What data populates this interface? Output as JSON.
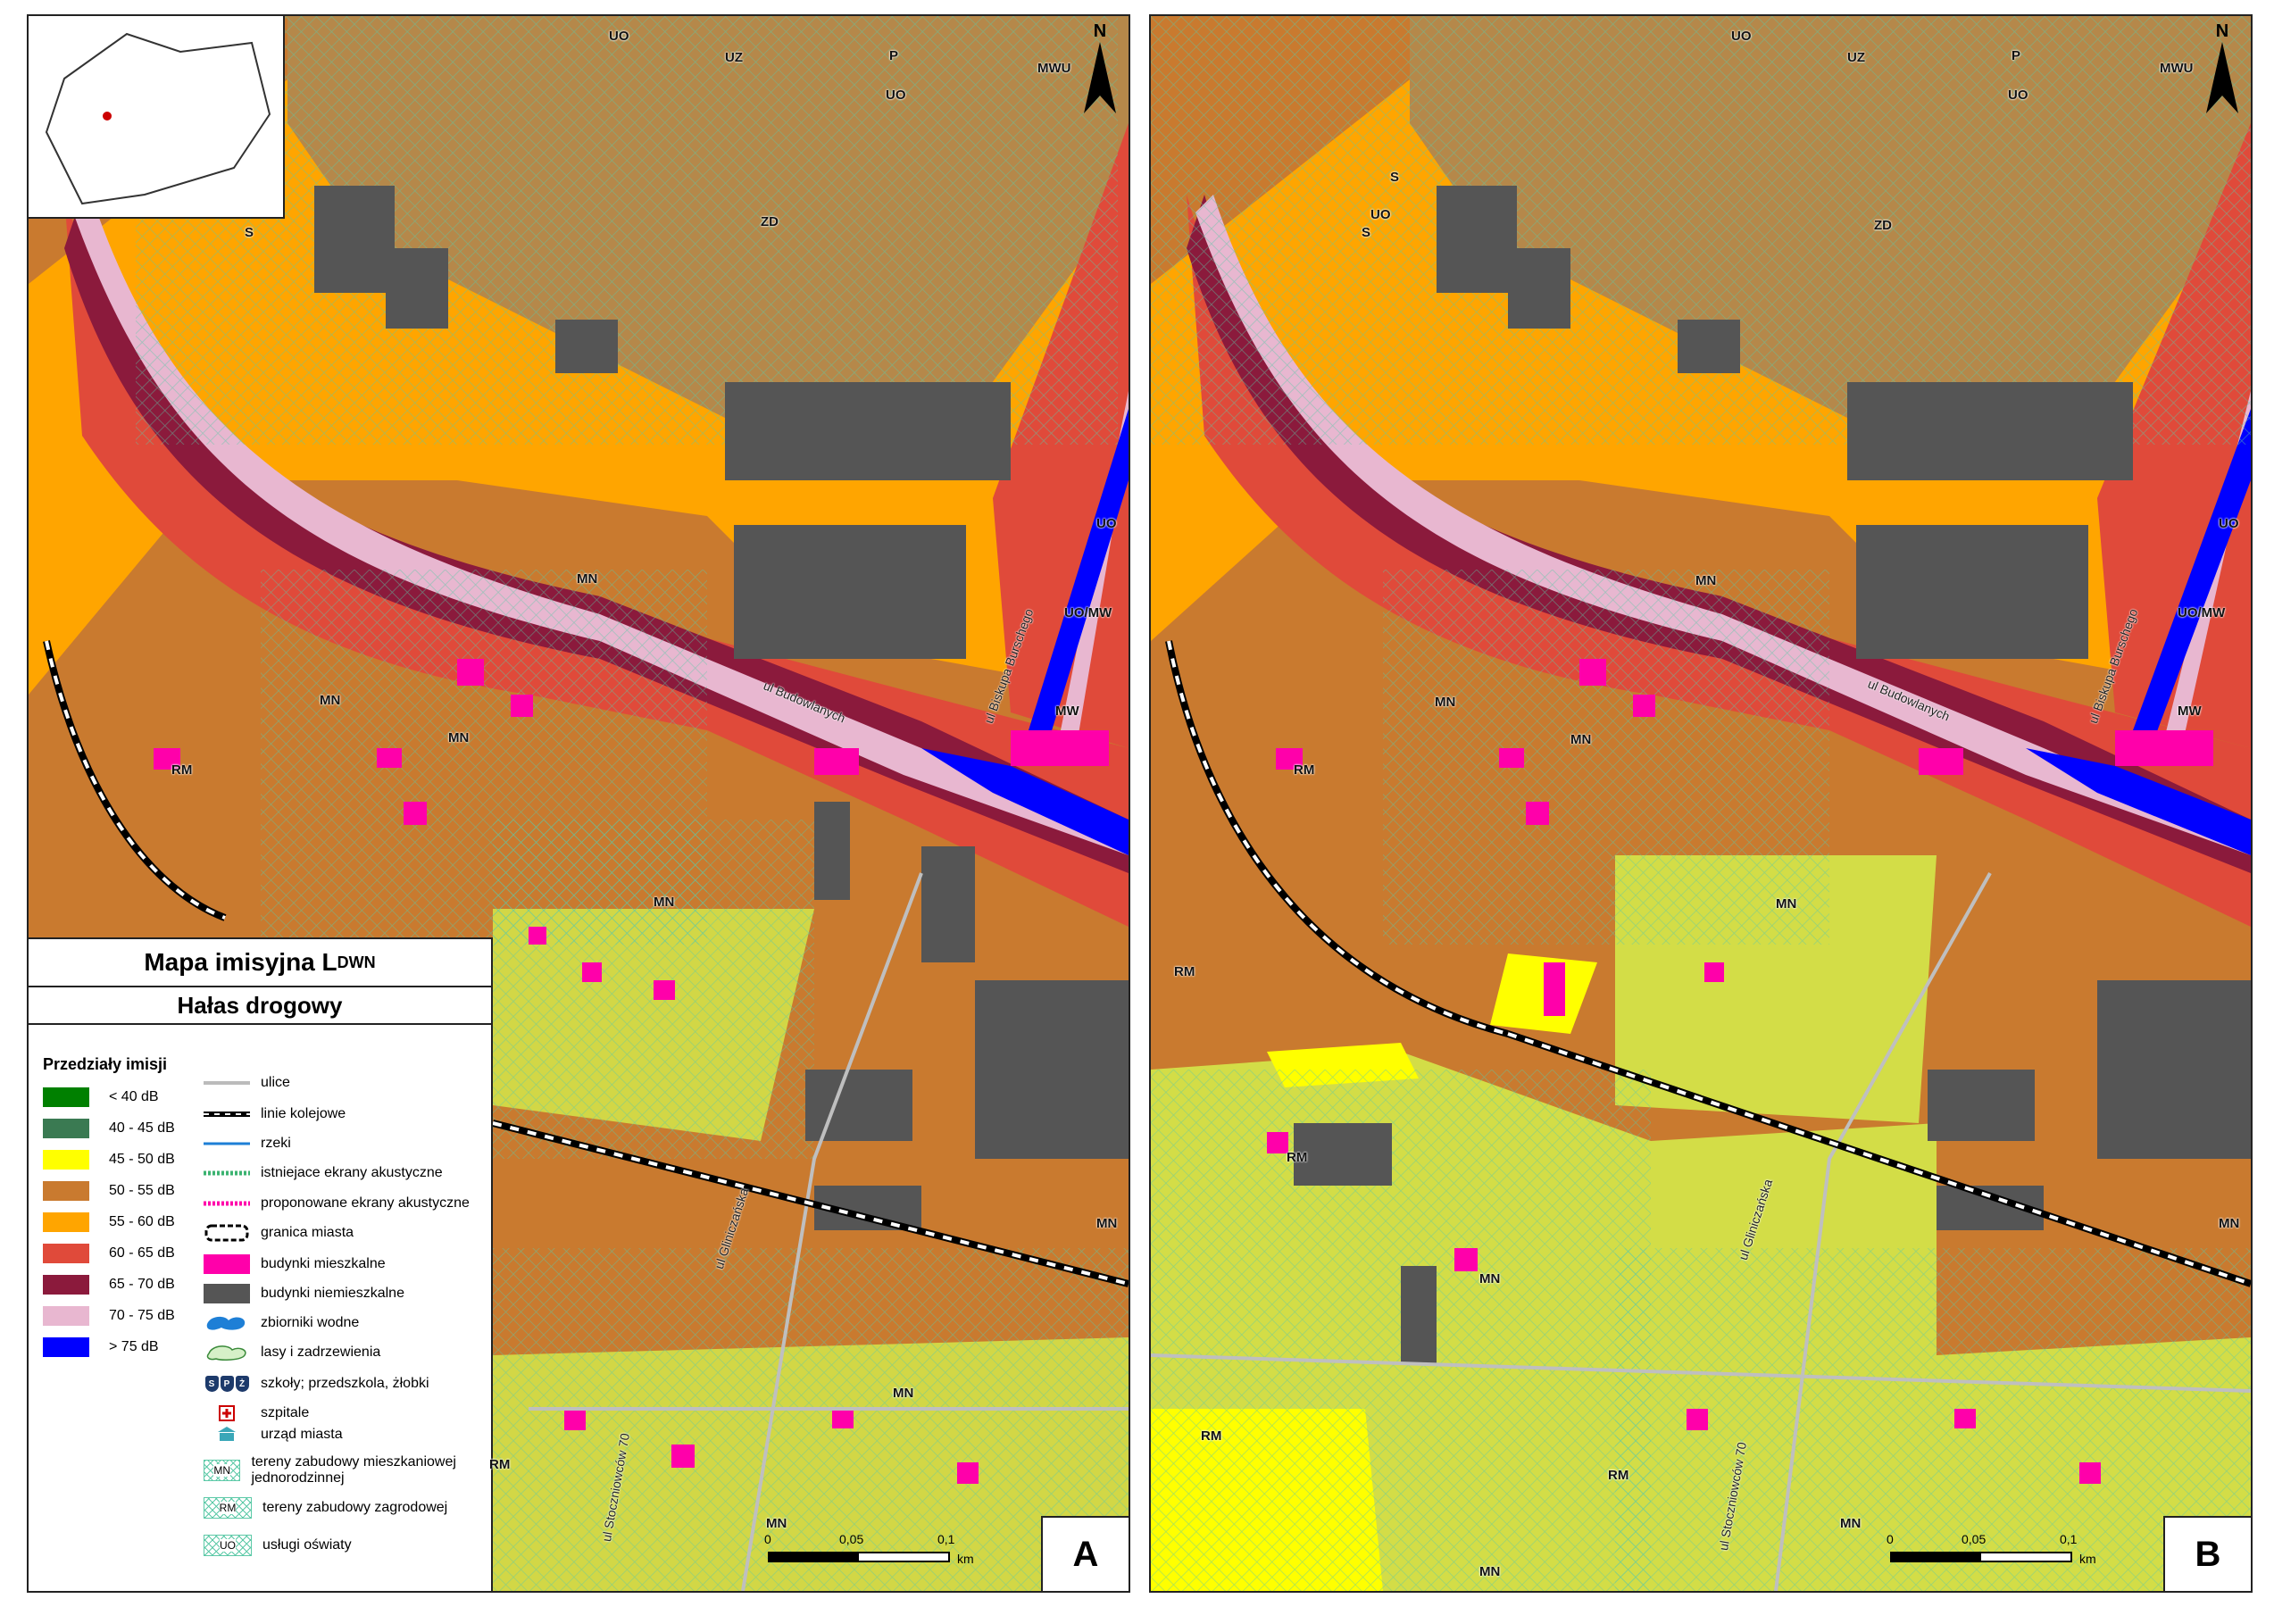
{
  "panels": [
    {
      "letter": "A"
    },
    {
      "letter": "B"
    }
  ],
  "north_label": "N",
  "scale": {
    "t0": "0",
    "t1": "0,05",
    "t2": "0,1",
    "unit": "km"
  },
  "streets": {
    "budowlanych": "ul Budowlanych",
    "burschego": "ul Biskupa Burschego",
    "gliniczanska": "ul Gliniczańska",
    "stoczniowcow": "ul Stoczniowców 70"
  },
  "zones": {
    "UO": "UO",
    "UZ": "UZ",
    "ZD": "ZD",
    "MN": "MN",
    "RM": "RM",
    "MW": "MW",
    "MWU": "MWU",
    "UO_MW": "UO/MW",
    "P": "P",
    "S": "S"
  },
  "legend": {
    "title_main": "Mapa imisyjna L",
    "title_sub": "DWN",
    "subtitle": "Hałas drogowy",
    "ranges_header": "Przedziały imisji",
    "ranges": [
      {
        "label": "< 40 dB",
        "color": "#008000"
      },
      {
        "label": "40 - 45 dB",
        "color": "#3a7a52"
      },
      {
        "label": "45 - 50 dB",
        "color": "#ffff00"
      },
      {
        "label": "50 - 55 dB",
        "color": "#c97a2f"
      },
      {
        "label": "55 - 60 dB",
        "color": "#ffa500"
      },
      {
        "label": "60 - 65 dB",
        "color": "#e04a3a"
      },
      {
        "label": "65 - 70 dB",
        "color": "#8b1a3c"
      },
      {
        "label": "70 - 75 dB",
        "color": "#e8b7d0"
      },
      {
        "label": "> 75 dB",
        "color": "#0000ff"
      }
    ],
    "symbols": [
      {
        "label": "ulice",
        "icon": "street-line"
      },
      {
        "label": "linie kolejowe",
        "icon": "railway-line"
      },
      {
        "label": "rzeki",
        "icon": "river-line"
      },
      {
        "label": "istniejace ekrany akustyczne",
        "icon": "existing-screen"
      },
      {
        "label": "proponowane ekrany akustyczne",
        "icon": "proposed-screen"
      },
      {
        "label": "granica miasta",
        "icon": "city-boundary"
      },
      {
        "label": "budynki mieszkalne",
        "icon": "residential-building"
      },
      {
        "label": "budynki niemieszkalne",
        "icon": "non-residential-building"
      },
      {
        "label": "zbiorniki wodne",
        "icon": "water-body"
      },
      {
        "label": "lasy i zadrzewienia",
        "icon": "forest"
      },
      {
        "label": "szkoły; przedszkola, żłobki",
        "icon": "school"
      },
      {
        "label": "szpitale",
        "icon": "hospital"
      },
      {
        "label": "urząd miasta",
        "icon": "city-hall"
      },
      {
        "label": "tereny zabudowy mieszkaniowej jednorodzinnej",
        "code": "MN"
      },
      {
        "label": "tereny zabudowy zagrodowej",
        "code": "RM"
      },
      {
        "label": "usługi oświaty",
        "code": "UO"
      }
    ],
    "symbol_codes": {
      "s": "S",
      "p": "P",
      "z": "Ż"
    }
  }
}
